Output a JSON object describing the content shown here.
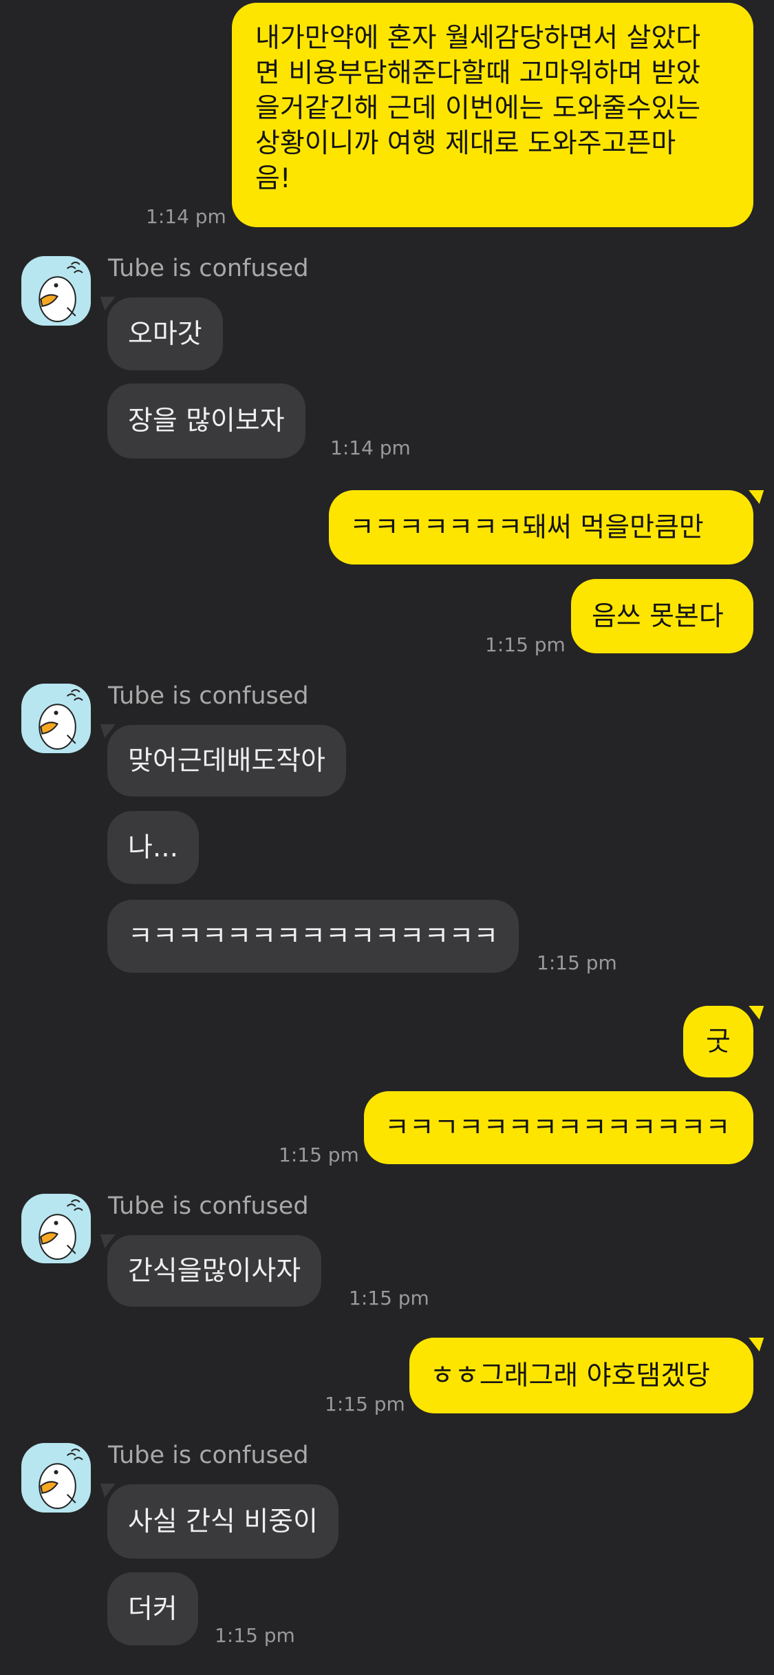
{
  "colors": {
    "background": "#242426",
    "my_bubble": "#FEE500",
    "their_bubble": "#3a3a3c",
    "time_text": "#9a9a9a",
    "sender_text": "#a9a9a9",
    "avatar_bg": "#b7e6f0"
  },
  "contact": {
    "name": "Tube is confused",
    "avatar_icon": "tube-duck-avatar-icon"
  },
  "messages": [
    {
      "from": "me",
      "lines": [
        "내가만약에 혼자 월세감당하면서 살았다",
        "면 비용부담해준다할때 고마워하며 받았",
        "을거같긴해 근데 이번에는 도와줄수있는",
        "상황이니까 여행 제대로 도와주고픈마",
        "음!"
      ],
      "time": "1:14 pm"
    },
    {
      "from": "them",
      "text": "오마갓",
      "time": ""
    },
    {
      "from": "them",
      "text": "장을 많이보자",
      "time": "1:14 pm"
    },
    {
      "from": "me",
      "text": "ㅋㅋㅋㅋㅋㅋㅋ돼써 먹을만큼만",
      "time": ""
    },
    {
      "from": "me",
      "text": "음쓰 못본다",
      "time": "1:15 pm"
    },
    {
      "from": "them",
      "text": "맞어근데배도작아",
      "time": ""
    },
    {
      "from": "them",
      "text": "나...",
      "time": ""
    },
    {
      "from": "them",
      "text": "ㅋㅋㅋㅋㅋㅋㅋㅋㅋㅋㅋㅋㅋㅋㅋ",
      "time": "1:15 pm"
    },
    {
      "from": "me",
      "text": "굿",
      "time": ""
    },
    {
      "from": "me",
      "text": "ㅋㅋㄱㅋㅋㅋㅋㅋㅋㅋㅋㅋㅋㅋ",
      "time": "1:15 pm"
    },
    {
      "from": "them",
      "text": "간식을많이사자",
      "time": "1:15 pm"
    },
    {
      "from": "me",
      "text": "ㅎㅎ그래그래 야호댐겠당",
      "time": "1:15 pm"
    },
    {
      "from": "them",
      "text": "사실 간식 비중이",
      "time": ""
    },
    {
      "from": "them",
      "text": "더커",
      "time": "1:15 pm"
    }
  ]
}
